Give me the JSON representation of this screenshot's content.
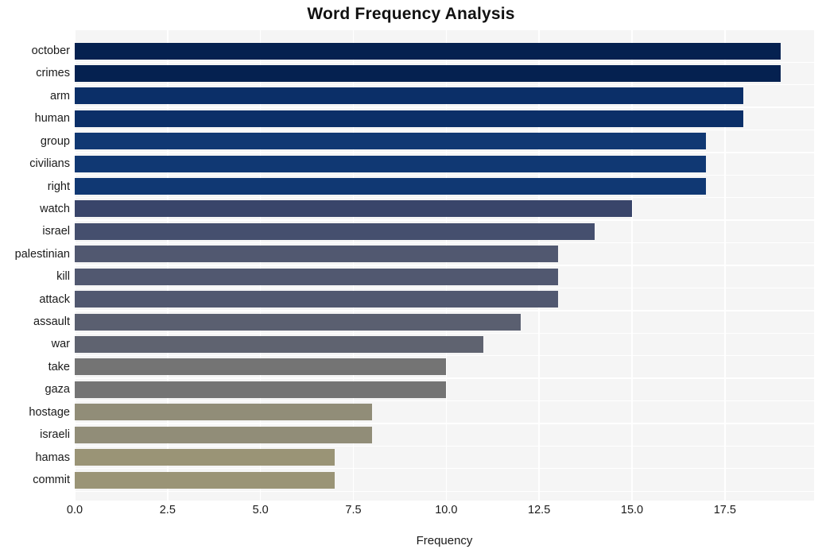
{
  "chart_data": {
    "type": "bar",
    "orientation": "horizontal",
    "title": "Word Frequency Analysis",
    "xlabel": "Frequency",
    "ylabel": "",
    "xlim": [
      0,
      19.9
    ],
    "xticks": [
      0.0,
      2.5,
      5.0,
      7.5,
      10.0,
      12.5,
      15.0,
      17.5
    ],
    "xtick_labels": [
      "0.0",
      "2.5",
      "5.0",
      "7.5",
      "10.0",
      "12.5",
      "15.0",
      "17.5"
    ],
    "grid": true,
    "legend": null,
    "categories": [
      "october",
      "crimes",
      "arm",
      "human",
      "group",
      "civilians",
      "right",
      "watch",
      "israel",
      "palestinian",
      "kill",
      "attack",
      "assault",
      "war",
      "take",
      "gaza",
      "hostage",
      "israeli",
      "hamas",
      "commit"
    ],
    "values": [
      19,
      19,
      18,
      18,
      17,
      17,
      17,
      15,
      14,
      13,
      13,
      13,
      12,
      11,
      10,
      10,
      8,
      8,
      7,
      7
    ],
    "bar_colors": [
      "#052150",
      "#052150",
      "#0b2f68",
      "#0b2f68",
      "#103873",
      "#103873",
      "#103873",
      "#39456a",
      "#454f6e",
      "#515870",
      "#515870",
      "#515870",
      "#5a5f70",
      "#5f6370",
      "#747474",
      "#747474",
      "#918d78",
      "#918d78",
      "#9a9476",
      "#9a9476"
    ],
    "plot_background": "#f5f5f5",
    "gridline_color": "#ffffff",
    "figure_background": "#ffffff"
  }
}
